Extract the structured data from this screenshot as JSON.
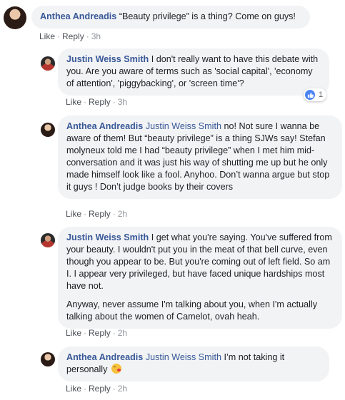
{
  "actions": {
    "like": "Like",
    "reply": "Reply",
    "separator": "·"
  },
  "comments": [
    {
      "author": "Anthea Andreadis",
      "mention": "",
      "paragraphs": [
        "“Beauty privilege” is a thing? Come on guys!"
      ],
      "time": "3h"
    },
    {
      "author": "Justin Weiss Smith",
      "mention": "",
      "paragraphs": [
        "I don't really want to have this debate with you. Are you aware of terms such as 'social capital', 'economy of attention', 'piggybacking', or 'screen time'?"
      ],
      "time": "3h",
      "reaction_count": "1"
    },
    {
      "author": "Anthea Andreadis",
      "mention": "Justin Weiss Smith",
      "paragraphs": [
        "no! Not sure I wanna be aware of them! But “beauty privilege” is a thing SJWs say! Stefan molyneux told me I had “beauty privilege” when I met him mid-conversation and it was just his way of shutting me up but he only made himself look like a fool. Anyhoo. Don’t wanna argue but stop it guys ! Don’t judge books by their covers"
      ],
      "time": "2h"
    },
    {
      "author": "Justin Weiss Smith",
      "mention": "",
      "paragraphs": [
        "I get what you're saying. You've suffered from your beauty. I wouldn't put you in the meat of that bell curve, even though you appear to be. But you're coming out of left field. So am I. I appear very privileged, but have faced unique hardships most have not.",
        "Anyway, never assume I'm talking about you, when I'm actually talking about the women of Camelot, ovah heah."
      ],
      "time": "2h"
    },
    {
      "author": "Anthea Andreadis",
      "mention": "Justin Weiss Smith",
      "paragraphs": [
        "I’m not taking it personally"
      ],
      "time": "2h",
      "emoji": "kissing-heart-emoji"
    }
  ]
}
